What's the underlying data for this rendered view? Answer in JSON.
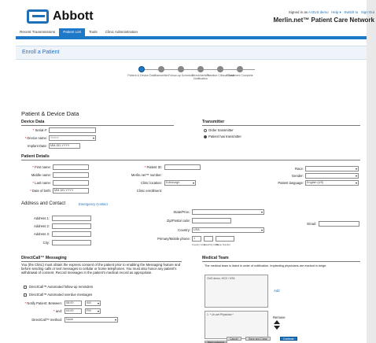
{
  "brand": {
    "logo_text": "Abbott"
  },
  "header": {
    "signed_in_prefix": "Signed in as",
    "user": "A OUS demo",
    "links": [
      "Help ▾",
      "Switch to",
      "Sign Out"
    ],
    "network_title": "Merlin.net™ Patient Care Network"
  },
  "nav": {
    "tabs": [
      {
        "label": "Recent Transmissions",
        "active": false
      },
      {
        "label": "Patient List",
        "active": true
      },
      {
        "label": "Tools",
        "active": false
      },
      {
        "label": "Clinic Administration",
        "active": false
      }
    ]
  },
  "page": {
    "title": "Enroll a Patient"
  },
  "stepper": {
    "steps": [
      {
        "label": "Patient & Device Data",
        "current": true
      },
      {
        "label": "Transmitter",
        "current": false
      },
      {
        "label": "Follow-up Schedule",
        "current": false
      },
      {
        "label": "DirectAlerts™ Notification",
        "current": false
      },
      {
        "label": "Baseline Clinical Data",
        "current": false
      },
      {
        "label": "Enrollment Complete",
        "current": false
      }
    ]
  },
  "patient_device": {
    "title": "Patient & Device Data",
    "device_data": {
      "title": "Device Data",
      "serial_label": "Serial #:",
      "serial_value": "",
      "device_name_label": "Device name:",
      "device_name_value": "Select",
      "implant_date_label": "Implant Date:",
      "implant_date_value": "MM-DD-YYYY"
    },
    "transmitter": {
      "title": "Transmitter",
      "option_order": "Order transmitter",
      "option_has": "Patient has transmitter",
      "selected": "Patient has transmitter"
    }
  },
  "patient_details": {
    "title": "Patient Details",
    "first_name_label": "First name:",
    "middle_name_label": "Middle name:",
    "last_name_label": "Last name:",
    "dob_label": "Date of birth:",
    "dob_value": "MM-DD-YYYY",
    "patient_id_label": "Patient ID:",
    "merlin_number_label": "Merlin.net™ number:",
    "clinic_location_label": "Clinic location:",
    "clinic_location_value": "Edinburgh",
    "clinic_enrollment_label": "Clinic enrollment:",
    "race_label": "Race:",
    "gender_label": "Gender:",
    "language_label": "Patient language:",
    "language_value": "English (US)"
  },
  "address": {
    "title": "Address and Contact",
    "emergency_link": "Emergency Contact",
    "address1_label": "Address 1:",
    "address2_label": "Address 2:",
    "address3_label": "Address 3:",
    "city_label": "City:",
    "state_label": "State/Prov.:",
    "zip_label": "Zip/Postal code:",
    "country_label": "Country:",
    "country_value": "USA",
    "phone_label": "Primary/Mobile phone:",
    "phone_country_code": "1",
    "phone_sub_labels": [
      "Country Code",
      "Area/City Code",
      "Phone Number"
    ],
    "email_label": "Email:"
  },
  "directcall": {
    "title": "DirectCall™ Messaging",
    "consent_text": "You (the Clinic) must obtain the express consent of the patient prior to enabling the Messaging feature and before sending calls or text messages to cellular or home telephones. You must also honor any patient's withdrawal of consent. Record messages in the patient's medical record as appropriate.",
    "opt_followup": "DirectCall™ Automated follow-up reminders",
    "opt_overdue": "DirectCall™ Automated overdue messages",
    "notify_label": "Notify Patient: Between:",
    "notify_from": "08:00",
    "notify_from_ampm": "AM",
    "and_label": "and:",
    "notify_to": "04:00",
    "notify_to_ampm": "PM",
    "method_label": "DirectCall™ method:",
    "method_value": "None"
  },
  "medical_team": {
    "title": "Medical Team",
    "intro": "The medical team is listed in order of notification. Implanting physicians are marked in beige.",
    "available_entry": "OUS demo, HCO / NTA",
    "add_link": "Add",
    "assigned_entry": "1. * Un-set Physician *",
    "remove_link": "Remove",
    "mark_button": "Mark implanting"
  },
  "footer": {
    "cancel": "Cancel",
    "save_close": "Save and Close",
    "continue": "Continue"
  }
}
